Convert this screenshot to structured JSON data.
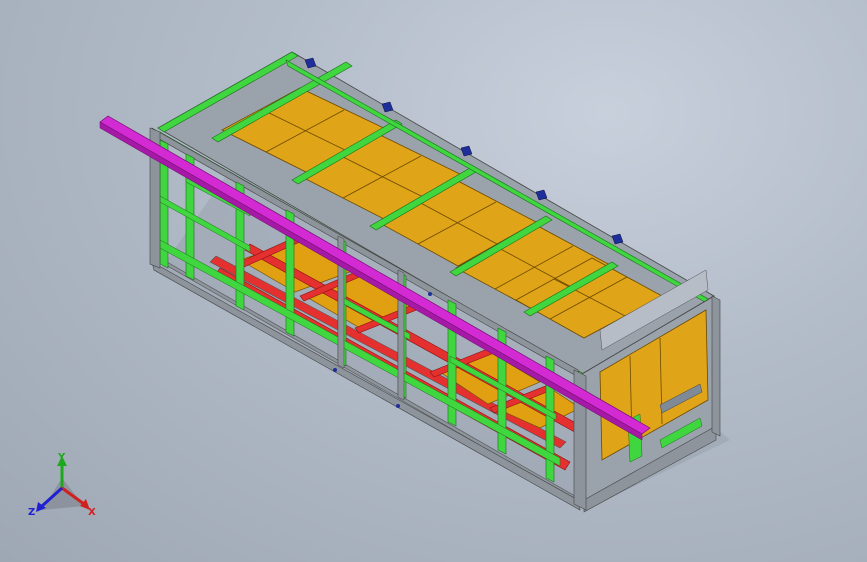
{
  "triad": {
    "x_label": "X",
    "y_label": "Y",
    "z_label": "Z"
  },
  "colors": {
    "frame_grey": "#8d949c",
    "beam_green": "#3fd63f",
    "floor_red": "#e53030",
    "panel_orange": "#e0a012",
    "rail_magenta": "#d42ad4",
    "clamp_blue": "#1f2f9a"
  }
}
